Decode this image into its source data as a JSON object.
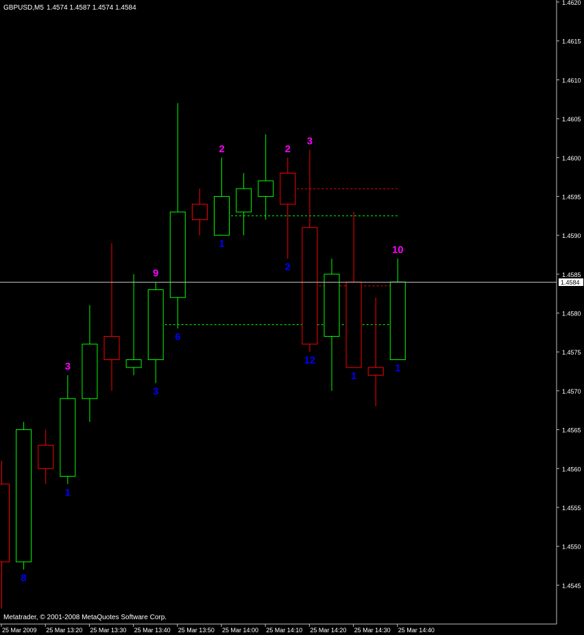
{
  "header": {
    "symbol": "GBPUSD,M5",
    "ohlc": "1.4574 1.4587 1.4574 1.4584"
  },
  "footer": {
    "copyright": "Metatrader, © 2001-2008 MetaQuotes Software Corp."
  },
  "colors": {
    "background": "#000000",
    "grid_frame": "#c0c0c0",
    "bull": "#00ff00",
    "bear": "#ff0000",
    "top_count": "#ff00ff",
    "bottom_count": "#0000ff",
    "text": "#ffffff"
  },
  "price_axis": {
    "min": 1.454,
    "max": 1.462,
    "ticks": [
      "1.4620",
      "1.4615",
      "1.4610",
      "1.4605",
      "1.4600",
      "1.4595",
      "1.4590",
      "1.4585",
      "1.4580",
      "1.4575",
      "1.4570",
      "1.4565",
      "1.4560",
      "1.4555",
      "1.4550",
      "1.4545"
    ],
    "current_price_label": "1.4584",
    "current_price": 1.4584
  },
  "time_axis": {
    "labels": [
      "25 Mar 2009",
      "25 Mar 13:20",
      "25 Mar 13:30",
      "25 Mar 13:40",
      "25 Mar 13:50",
      "25 Mar 14:00",
      "25 Mar 14:10",
      "25 Mar 14:20",
      "25 Mar 14:30",
      "25 Mar 14:40"
    ]
  },
  "chart_data": {
    "type": "candlestick",
    "symbol": "GBPUSD",
    "timeframe": "M5",
    "candles": [
      {
        "open": 1.4558,
        "high": 1.4561,
        "low": 1.4542,
        "close": 1.4548
      },
      {
        "open": 1.4548,
        "high": 1.4566,
        "low": 1.4547,
        "close": 1.4565
      },
      {
        "open": 1.4563,
        "high": 1.4565,
        "low": 1.4558,
        "close": 1.456
      },
      {
        "open": 1.4559,
        "high": 1.4572,
        "low": 1.4558,
        "close": 1.4569
      },
      {
        "open": 1.4569,
        "high": 1.4581,
        "low": 1.4566,
        "close": 1.4576
      },
      {
        "open": 1.4577,
        "high": 1.4589,
        "low": 1.457,
        "close": 1.4574
      },
      {
        "open": 1.4573,
        "high": 1.4585,
        "low": 1.4572,
        "close": 1.4574
      },
      {
        "open": 1.4574,
        "high": 1.4584,
        "low": 1.4571,
        "close": 1.4583
      },
      {
        "open": 1.4582,
        "high": 1.4607,
        "low": 1.4578,
        "close": 1.4593
      },
      {
        "open": 1.4594,
        "high": 1.4596,
        "low": 1.459,
        "close": 1.4592
      },
      {
        "open": 1.459,
        "high": 1.46,
        "low": 1.459,
        "close": 1.4595
      },
      {
        "open": 1.4593,
        "high": 1.4598,
        "low": 1.459,
        "close": 1.4596
      },
      {
        "open": 1.4595,
        "high": 1.4603,
        "low": 1.4592,
        "close": 1.4597
      },
      {
        "open": 1.4598,
        "high": 1.46,
        "low": 1.4587,
        "close": 1.4594
      },
      {
        "open": 1.4591,
        "high": 1.4601,
        "low": 1.4575,
        "close": 1.4576
      },
      {
        "open": 1.4577,
        "high": 1.4587,
        "low": 1.457,
        "close": 1.4585
      },
      {
        "open": 1.4584,
        "high": 1.4593,
        "low": 1.4573,
        "close": 1.4573
      },
      {
        "open": 1.4573,
        "high": 1.4582,
        "low": 1.4568,
        "close": 1.4572
      },
      {
        "open": 1.4574,
        "high": 1.4587,
        "low": 1.4574,
        "close": 1.4584
      }
    ],
    "top_counts": [
      {
        "candle": 3,
        "label": "3"
      },
      {
        "candle": 7,
        "label": "9"
      },
      {
        "candle": 10,
        "label": "2"
      },
      {
        "candle": 13,
        "label": "2"
      },
      {
        "candle": 14,
        "label": "3"
      },
      {
        "candle": 18,
        "label": "10"
      }
    ],
    "bottom_counts": [
      {
        "candle": 1,
        "label": "8"
      },
      {
        "candle": 3,
        "label": "1"
      },
      {
        "candle": 7,
        "label": "3"
      },
      {
        "candle": 8,
        "label": "6"
      },
      {
        "candle": 10,
        "label": "1"
      },
      {
        "candle": 13,
        "label": "2"
      },
      {
        "candle": 14,
        "label": "12"
      },
      {
        "candle": 16,
        "label": "1"
      },
      {
        "candle": 18,
        "label": "1"
      }
    ],
    "levels": [
      {
        "price": 1.4596,
        "color": "#ff0000",
        "from_candle": 13,
        "to_candle": 18
      },
      {
        "price": 1.45925,
        "color": "#00ff00",
        "from_candle": 10,
        "to_candle": 18
      },
      {
        "price": 1.45835,
        "color": "#ff0000",
        "from_candle": 14,
        "to_candle": 18
      },
      {
        "price": 1.45785,
        "color": "#00ff00",
        "from_candle": 7,
        "to_candle": 18
      }
    ]
  }
}
